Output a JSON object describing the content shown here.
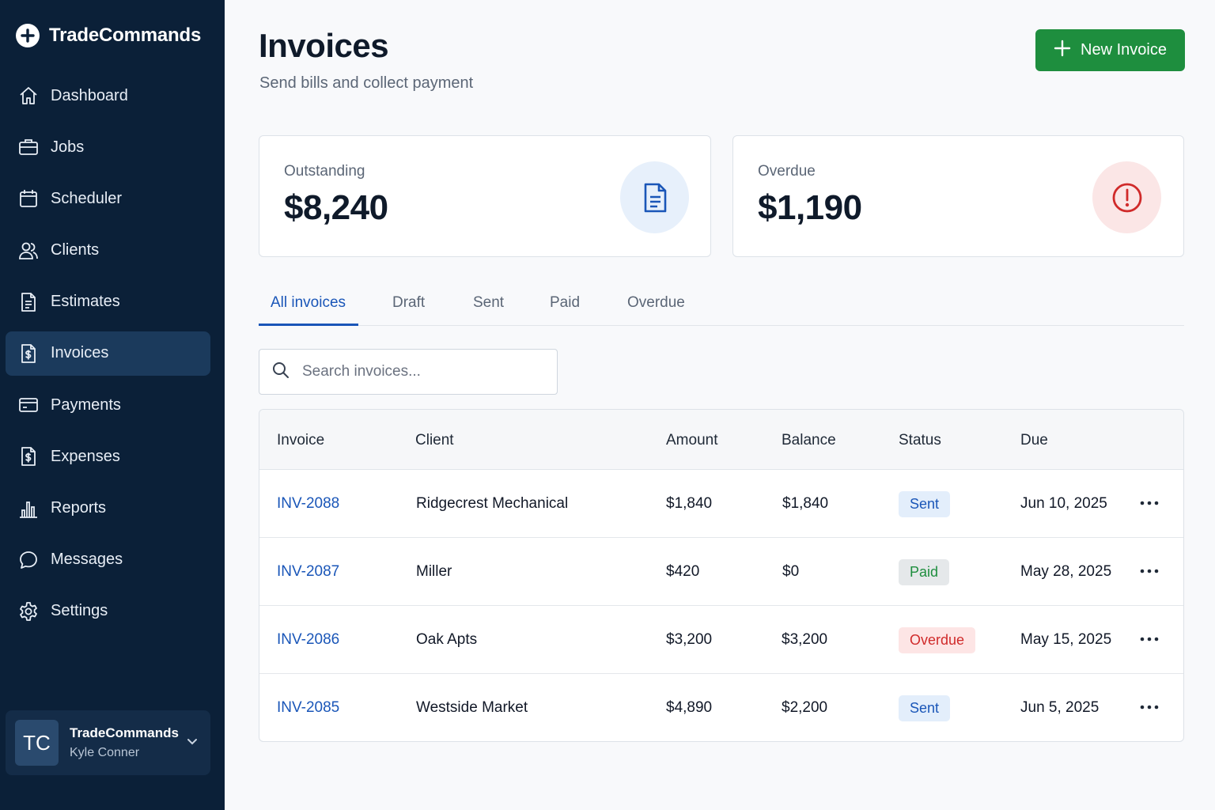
{
  "brand": {
    "name": "TradeCommands",
    "logo_icon": "plus-circle-icon"
  },
  "sidebar": {
    "items": [
      {
        "label": "Dashboard",
        "icon": "home-icon"
      },
      {
        "label": "Jobs",
        "icon": "briefcase-icon"
      },
      {
        "label": "Scheduler",
        "icon": "calendar-icon"
      },
      {
        "label": "Clients",
        "icon": "users-icon"
      },
      {
        "label": "Estimates",
        "icon": "document-icon"
      },
      {
        "label": "Invoices",
        "icon": "invoice-dollar-icon",
        "active": true
      },
      {
        "label": "Payments",
        "icon": "credit-card-icon"
      },
      {
        "label": "Expenses",
        "icon": "receipt-dollar-icon"
      },
      {
        "label": "Reports",
        "icon": "bar-chart-icon"
      },
      {
        "label": "Messages",
        "icon": "chat-bubble-icon"
      },
      {
        "label": "Settings",
        "icon": "gear-icon"
      }
    ],
    "user": {
      "initials": "TC",
      "org": "TradeCommands",
      "name": "Kyle Conner"
    }
  },
  "header": {
    "title": "Invoices",
    "subtitle": "Send bills and collect payment",
    "new_button_label": "New Invoice"
  },
  "stats": {
    "outstanding": {
      "label": "Outstanding",
      "value": "$8,240",
      "icon": "document-icon"
    },
    "overdue": {
      "label": "Overdue",
      "value": "$1,190",
      "icon": "alert-circle-icon"
    }
  },
  "tabs": [
    {
      "label": "All invoices",
      "active": true
    },
    {
      "label": "Draft"
    },
    {
      "label": "Sent"
    },
    {
      "label": "Paid"
    },
    {
      "label": "Overdue"
    }
  ],
  "search": {
    "placeholder": "Search invoices...",
    "value": ""
  },
  "table": {
    "columns": [
      "Invoice",
      "Client",
      "Amount",
      "Balance",
      "Status",
      "Due"
    ],
    "rows": [
      {
        "invoice": "INV-2088",
        "client": "Ridgecrest Mechanical",
        "amount": "$1,840",
        "balance": "$1,840",
        "status": "Sent",
        "due": "Jun 10, 2025"
      },
      {
        "invoice": "INV-2087",
        "client": "Miller",
        "amount": "$420",
        "balance": "$0",
        "status": "Paid",
        "due": "May 28, 2025"
      },
      {
        "invoice": "INV-2086",
        "client": "Oak Apts",
        "amount": "$3,200",
        "balance": "$3,200",
        "status": "Overdue",
        "due": "May 15, 2025"
      },
      {
        "invoice": "INV-2085",
        "client": "Westside Market",
        "amount": "$4,890",
        "balance": "$2,200",
        "status": "Sent",
        "due": "Jun 5, 2025"
      }
    ]
  },
  "colors": {
    "sidebar_bg": "#0b2038",
    "active_nav": "#1b3a5c",
    "accent_blue": "#1a56b8",
    "primary_green": "#1e8e3e",
    "danger_red": "#d02a2a"
  }
}
